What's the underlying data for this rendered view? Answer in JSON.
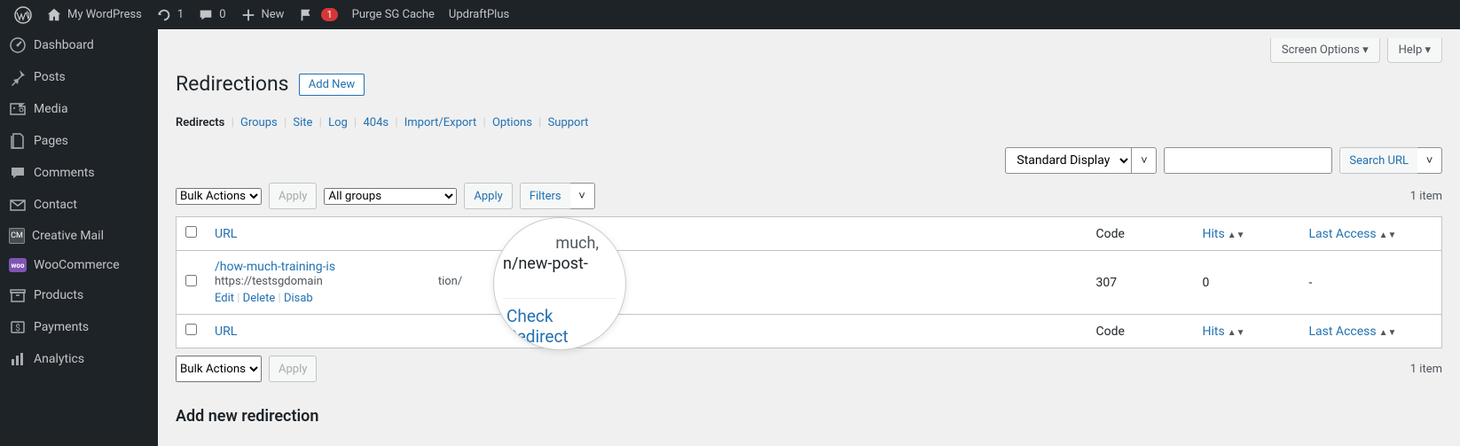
{
  "adminBar": {
    "siteName": "My WordPress",
    "updates": "1",
    "comments": "0",
    "new": "New",
    "notifications": "1",
    "purge": "Purge SG Cache",
    "updraft": "UpdraftPlus"
  },
  "sidebar": {
    "items": [
      {
        "label": "Dashboard",
        "icon": "dashboard"
      },
      {
        "label": "Posts",
        "icon": "pin"
      },
      {
        "label": "Media",
        "icon": "media"
      },
      {
        "label": "Pages",
        "icon": "pages"
      },
      {
        "label": "Comments",
        "icon": "comment"
      },
      {
        "label": "Contact",
        "icon": "mail"
      },
      {
        "label": "Creative Mail",
        "icon": "cm"
      },
      {
        "label": "WooCommerce",
        "icon": "woo"
      },
      {
        "label": "Products",
        "icon": "archive"
      },
      {
        "label": "Payments",
        "icon": "dollar"
      },
      {
        "label": "Analytics",
        "icon": "chart"
      }
    ]
  },
  "screenOptions": "Screen Options",
  "help": "Help",
  "page": {
    "title": "Redirections",
    "addNew": "Add New"
  },
  "subnav": {
    "redirects": "Redirects",
    "groups": "Groups",
    "site": "Site",
    "log": "Log",
    "f404s": "404s",
    "importExport": "Import/Export",
    "options": "Options",
    "support": "Support"
  },
  "filters": {
    "displayMode": "Standard Display",
    "searchPlaceholder": "",
    "searchBtn": "Search URL",
    "bulkActions": "Bulk Actions",
    "apply": "Apply",
    "allGroups": "All groups",
    "filtersBtn": "Filters"
  },
  "itemCount": "1 item",
  "table": {
    "headers": {
      "url": "URL",
      "code": "Code",
      "hits": "Hits",
      "lastAccess": "Last Access"
    },
    "rows": [
      {
        "sourceUrl": "/how-much-training-is",
        "targetUrl": "https://testsgdomain",
        "targetSuffix": "tion/",
        "code": "307",
        "hits": "0",
        "lastAccess": "-"
      }
    ],
    "actions": {
      "edit": "Edit",
      "delete": "Delete",
      "disable": "Disab"
    }
  },
  "magnifier": {
    "line1": "much,",
    "line2": "n/new-post-",
    "link": "Check Redirect"
  },
  "addSection": "Add new redirection"
}
